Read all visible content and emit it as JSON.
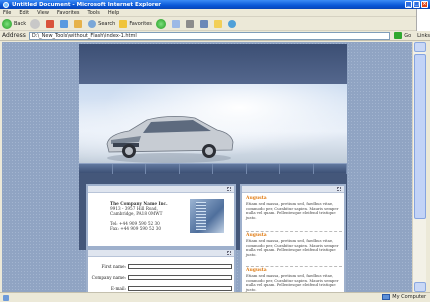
{
  "window": {
    "title": "Untitled Document - Microsoft Internet Explorer",
    "min": "_",
    "max": "□",
    "close": "×"
  },
  "menu": [
    "File",
    "Edit",
    "View",
    "Favorites",
    "Tools",
    "Help"
  ],
  "toolbar": {
    "back_label": "Back",
    "search_label": "Search",
    "favorites_label": "Favorites"
  },
  "address": {
    "label": "Address",
    "value": "D:\\_New_Tools\\without_Flash\\index-1.html",
    "go_label": "Go",
    "links_label": "Links"
  },
  "status": {
    "zone_label": "My Computer"
  },
  "site": {
    "company": {
      "name": "The Company Name Inc.",
      "address1": "9913 - 3957 Hill Road,",
      "address2": "Cambridge, PA18 0MWT",
      "tel": "Tel: +44 909 590 52 30",
      "fax": "Fax: +44 909 590 52 30"
    },
    "form": {
      "first_name": "First name:",
      "company_name": "Company name:",
      "email": "E-mail:"
    },
    "news": [
      {
        "title": "Augusta",
        "text": "Etiam sed massa, pretium sed, faedbus vitae, commodo per, Curabitur sapien. Mauris semper nulla vel quam. Pellentesque eleifend tristique justo."
      },
      {
        "title": "Augusta",
        "text": "Etiam sed massa, pretium sed, faedbus vitae, commodo per, Curabitur sapien. Mauris semper nulla vel quam. Pellentesque eleifend tristique justo."
      },
      {
        "title": "Augusta",
        "text": "Etiam sed massa, pretium sed, faedbus vitae, commodo per, Curabitur sapien. Mauris semper nulla vel quam. Pellentesque eleifend tristique justo."
      }
    ]
  }
}
